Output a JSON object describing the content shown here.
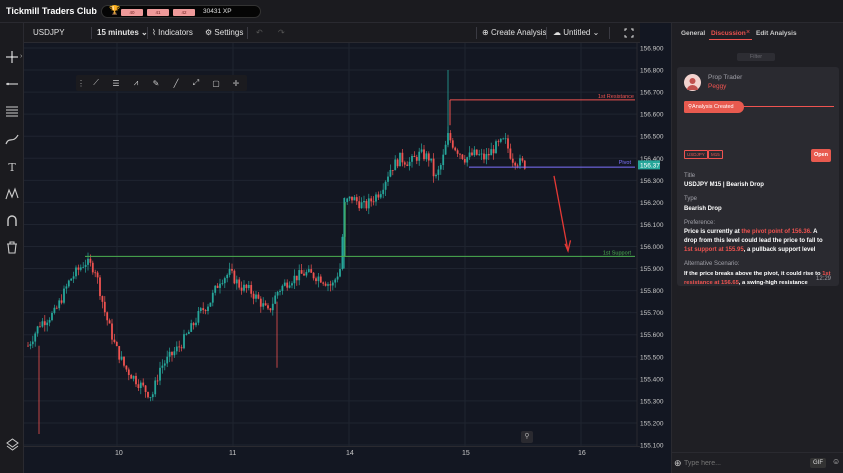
{
  "app": {
    "title": "Tickmill Traders Club",
    "xp_segments": [
      "40",
      "41",
      "42"
    ],
    "xp_value": "30431 XP"
  },
  "toolbar": {
    "symbol": "USDJPY",
    "timeframe": "15 minutes",
    "indicators_label": "Indicators",
    "settings_label": "Settings",
    "create_analysis_label": "Create Analysis",
    "layout_name": "Untitled"
  },
  "left_tools": [
    "crosshair-icon",
    "trendline-icon",
    "fib-icon",
    "brush-icon",
    "text-icon",
    "pattern-icon",
    "measure-icon",
    "trash-icon"
  ],
  "chart": {
    "price_ticks": [
      "156.900",
      "156.800",
      "156.700",
      "156.600",
      "156.500",
      "156.400",
      "156.300",
      "156.200",
      "156.100",
      "156.000",
      "155.900",
      "155.800",
      "155.700",
      "155.600",
      "155.500",
      "155.400",
      "155.300",
      "155.200",
      "155.100"
    ],
    "time_ticks": [
      "10",
      "11",
      "14",
      "15",
      "16"
    ],
    "current_price": "156.37",
    "lines": {
      "resistance": {
        "label": "1st Resistance",
        "color": "#ef5350"
      },
      "pivot": {
        "label": "Pivot",
        "color": "#7e72ff"
      },
      "support": {
        "label": "1st Support",
        "color": "#4caf50"
      }
    },
    "up_color": "#26a69a",
    "down_color": "#ef5350"
  },
  "panel": {
    "tabs": [
      "General",
      "Discussion",
      "Edit Analysis"
    ],
    "active_tab": "Discussion",
    "filter_label": "Filter",
    "author_role": "Prop Trader",
    "author_name": "Peggy",
    "status_label": "Analysis Created",
    "tags": [
      "USDJPY",
      "M15"
    ],
    "open_label": "Open",
    "title_label": "Title",
    "title_value": "USDJPY M15 | Bearish Drop",
    "type_label": "Type",
    "type_value": "Bearish Drop",
    "preference_label": "Preference:",
    "preference_p1": "Price is currently at ",
    "preference_h1": "the pivot point of 156.36.",
    "preference_p2": "  A drop from this level could lead the price to fall to ",
    "preference_h2": "1st support at 155.95",
    "preference_p3": ", a pullback support level",
    "alt_label": "Alternative Scenario:",
    "alt_p1": "If the price breaks above the pivot, it could rise to ",
    "alt_h1": "1st resistance at 156.65",
    "alt_p2": ", a swing-high resistance",
    "time": "12:29",
    "reply_placeholder": "Type here...",
    "gif_label": "GIF"
  }
}
